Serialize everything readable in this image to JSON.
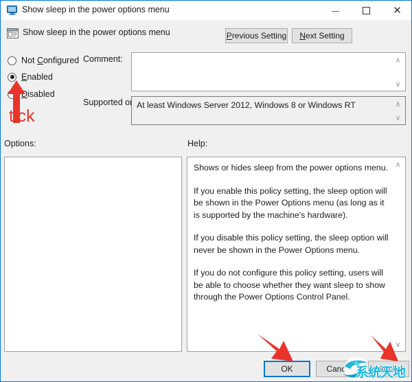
{
  "window": {
    "title": "Show sleep in the power options menu",
    "title_icon": "monitor-icon",
    "minimize_label": "—",
    "maximize_label": "□",
    "close_label": "✕"
  },
  "header": {
    "icon": "policy-setting-icon",
    "title": "Show sleep in the power options menu",
    "previous_setting": "Previous Setting",
    "previous_setting_pre": "P",
    "previous_setting_post": "revious Setting",
    "next_setting": "Next Setting",
    "next_setting_pre": "N",
    "next_setting_post": "ext Setting"
  },
  "state_options": [
    {
      "id": "not-configured",
      "label_pre": "Not ",
      "label_accel": "C",
      "label_post": "onfigured",
      "label": "Not Configured",
      "checked": false
    },
    {
      "id": "enabled",
      "label_pre": "",
      "label_accel": "E",
      "label_post": "nabled",
      "label": "Enabled",
      "checked": true
    },
    {
      "id": "disabled",
      "label_pre": "",
      "label_accel": "D",
      "label_post": "isabled",
      "label": "Disabled",
      "checked": false
    }
  ],
  "fields": {
    "comment_label": "Comment:",
    "comment_value": "",
    "supported_label": "Supported on:",
    "supported_value": "At least Windows Server 2012, Windows 8 or Windows RT",
    "options_label": "Options:",
    "options_value": "",
    "help_label": "Help:"
  },
  "help": {
    "paragraphs": [
      "Shows or hides sleep from the power options menu.",
      "If you enable this policy setting, the sleep option will be shown in the Power Options menu (as long as it is supported by the machine's hardware).",
      "If you disable this policy setting, the sleep option will never be shown in the Power Options menu.",
      "If you do not configure this policy setting, users will be able to choose whether they want sleep to show through the Power Options Control Panel."
    ]
  },
  "buttons": {
    "ok": "OK",
    "cancel": "Cancel",
    "apply": "Apply"
  },
  "annotations": {
    "tick_text": "tick",
    "color": "#e8342a"
  },
  "watermark": {
    "text": "系统天地",
    "color": "#18b6e0"
  },
  "scroll": {
    "up": "∧",
    "down": "∨"
  }
}
